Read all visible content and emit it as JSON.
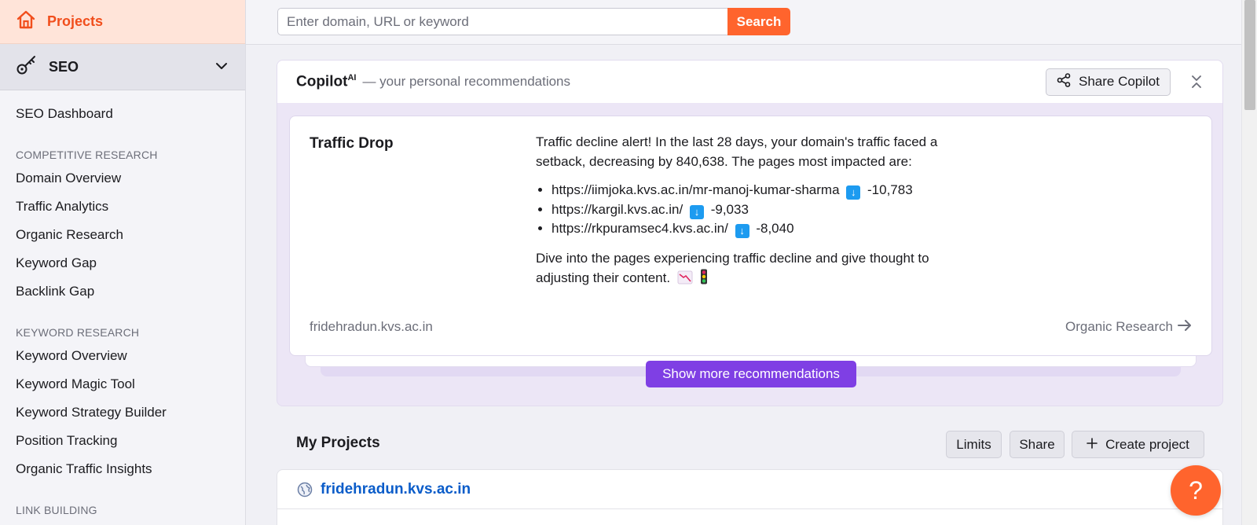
{
  "sidebar": {
    "projects_label": "Projects",
    "seo_label": "SEO",
    "items": {
      "seo_dashboard": "SEO Dashboard",
      "section_competitive": "COMPETITIVE RESEARCH",
      "domain_overview": "Domain Overview",
      "traffic_analytics": "Traffic Analytics",
      "organic_research": "Organic Research",
      "keyword_gap": "Keyword Gap",
      "backlink_gap": "Backlink Gap",
      "section_keyword": "KEYWORD RESEARCH",
      "keyword_overview": "Keyword Overview",
      "keyword_magic": "Keyword Magic Tool",
      "keyword_strategy": "Keyword Strategy Builder",
      "position_tracking": "Position Tracking",
      "organic_insights": "Organic Traffic Insights",
      "section_link": "LINK BUILDING"
    }
  },
  "search": {
    "placeholder": "Enter domain, URL or keyword",
    "button_label": "Search"
  },
  "copilot": {
    "title": "Copilot",
    "title_sup": "AI",
    "subtitle": "— your personal recommendations",
    "share_label": "Share Copilot",
    "card": {
      "title": "Traffic Drop",
      "intro": "Traffic decline alert! In the last 28 days, your domain's traffic faced a setback, decreasing by 840,638. The pages most impacted are:",
      "pages": [
        {
          "url": "https://iimjoka.kvs.ac.in/mr-manoj-kumar-sharma",
          "change": "-10,783"
        },
        {
          "url": "https://kargil.kvs.ac.in/",
          "change": "-9,033"
        },
        {
          "url": "https://rkpuramsec4.kvs.ac.in/",
          "change": "-8,040"
        }
      ],
      "outro": "Dive into the pages experiencing traffic decline and give thought to adjusting their content.",
      "domain": "fridehradun.kvs.ac.in",
      "link_label": "Organic Research"
    },
    "more_label": "Show more recommendations"
  },
  "projects": {
    "title": "My Projects",
    "limits_label": "Limits",
    "share_label": "Share",
    "create_label": "Create project",
    "items": [
      {
        "name": "fridehradun.kvs.ac.in"
      }
    ]
  },
  "help": {
    "label": "?"
  },
  "colors": {
    "accent": "#ff642d",
    "purple": "#7f3fe4",
    "link": "#0a5cc9"
  }
}
